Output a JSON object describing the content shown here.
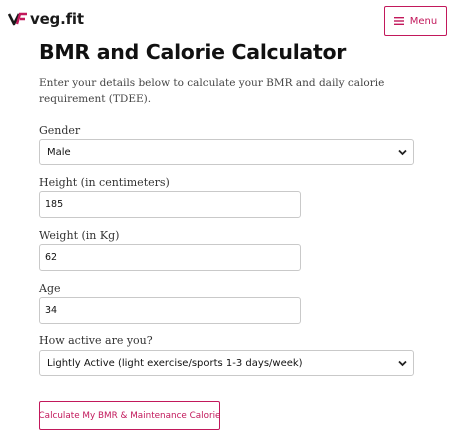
{
  "header": {
    "logo_text": "veg.fit",
    "menu_label": "Menu",
    "accent_color": "#c2185b"
  },
  "page": {
    "title": "BMR and Calorie Calculator",
    "intro": "Enter your details below to calculate your BMR and daily calorie requirement (TDEE)."
  },
  "form": {
    "gender": {
      "label": "Gender",
      "value": "Male"
    },
    "height": {
      "label": "Height (in centimeters)",
      "value": "185"
    },
    "weight": {
      "label": "Weight (in Kg)",
      "value": "62"
    },
    "age": {
      "label": "Age",
      "value": "34"
    },
    "activity": {
      "label": "How active are you?",
      "value": "Lightly Active (light exercise/sports 1-3 days/week)"
    },
    "submit_label": "Calculate My BMR & Maintenance Calorie"
  }
}
